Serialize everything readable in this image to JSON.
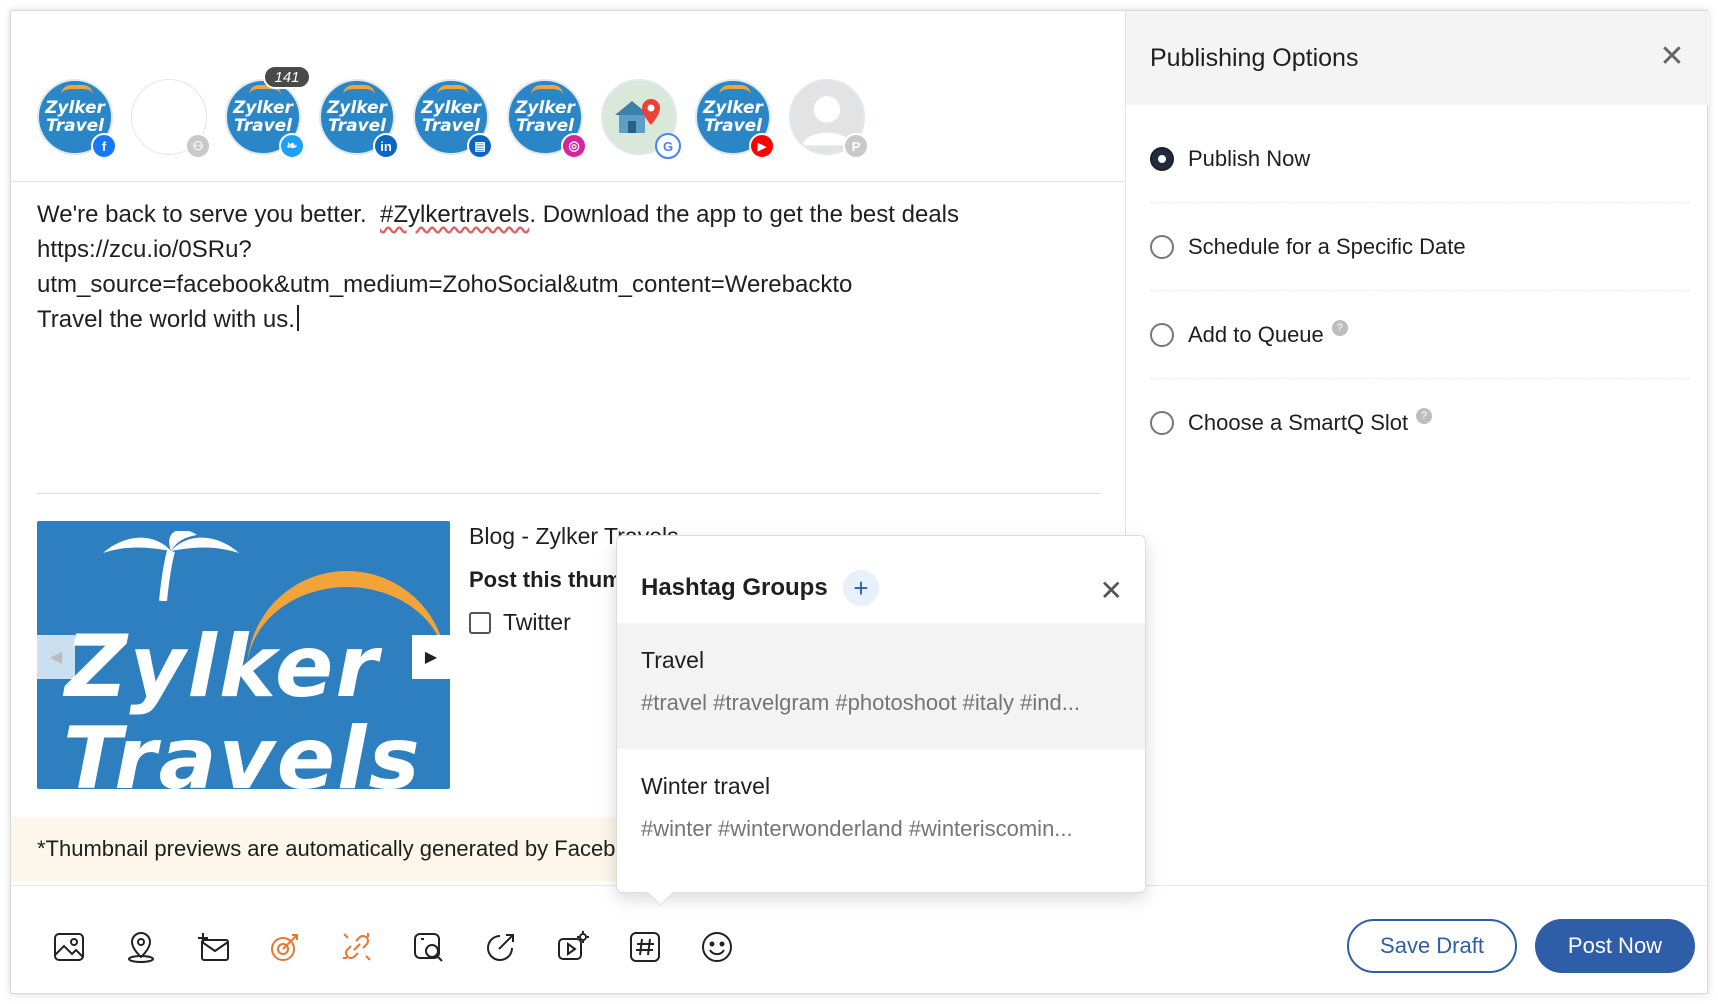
{
  "profiles": [
    {
      "name": "Zylker Travels",
      "network": "facebook",
      "badge_color": "#1877f2",
      "badge_glyph": "f"
    },
    {
      "name": "",
      "network": "group",
      "badge_color": "#c9c9c9",
      "badge_glyph": "⚇"
    },
    {
      "name": "Zylker Travels",
      "network": "twitter",
      "badge_color": "#1da1f2",
      "badge_glyph": "❧",
      "count": "141"
    },
    {
      "name": "Zylker Travels",
      "network": "linkedin",
      "badge_color": "#0a66c2",
      "badge_glyph": "in"
    },
    {
      "name": "Zylker Travels",
      "network": "linkedin-page",
      "badge_color": "#0a66c2",
      "badge_glyph": "▤"
    },
    {
      "name": "Zylker Travels",
      "network": "instagram",
      "badge_color": "#d6249f",
      "badge_glyph": "◎"
    },
    {
      "name": "",
      "network": "google-business",
      "badge_color": "#4285f4",
      "badge_glyph": "G"
    },
    {
      "name": "Zylker Travels",
      "network": "youtube",
      "badge_color": "#ff0000",
      "badge_glyph": "▶"
    },
    {
      "name": "",
      "network": "pinterest",
      "badge_color": "#c9c9c9",
      "badge_glyph": "P"
    }
  ],
  "post": {
    "line1_before": "We're back to serve you better.  ",
    "hashtag": "#Zylkertravels",
    "line1_after": ". Download the app to get the best deals",
    "line2": "https://zcu.io/0SRu?",
    "line3": "utm_source=facebook&utm_medium=ZohoSocial&utm_content=Werebackto",
    "line4": "Travel the world with us."
  },
  "link_preview": {
    "title": "Blog - Zylker Travels",
    "thumb_text_1": "Zylker",
    "thumb_text_2": "Travels",
    "post_thumbnail_label": "Post this thumbnail",
    "twitter_label": "Twitter",
    "note": "*Thumbnail previews are automatically generated by Facebook."
  },
  "toolbar": {
    "tools": [
      "image-icon",
      "location-icon",
      "mail-add-icon",
      "target-icon",
      "link-off-icon",
      "image-search-icon",
      "share-icon",
      "video-settings-icon",
      "hashtag-icon",
      "emoji-icon"
    ],
    "save_draft": "Save Draft",
    "post_now": "Post Now"
  },
  "publishing": {
    "title": "Publishing Options",
    "options": [
      {
        "label": "Publish Now",
        "selected": true,
        "help": false
      },
      {
        "label": "Schedule for a Specific Date",
        "selected": false,
        "help": false
      },
      {
        "label": "Add to Queue",
        "selected": false,
        "help": true
      },
      {
        "label": "Choose a SmartQ Slot",
        "selected": false,
        "help": true
      }
    ]
  },
  "hashtag_groups": {
    "title": "Hashtag Groups",
    "groups": [
      {
        "name": "Travel",
        "tags": "#travel #travelgram #photoshoot #italy #ind..."
      },
      {
        "name": "Winter travel",
        "tags": "#winter #winterwonderland #winteriscomin..."
      }
    ]
  },
  "colors": {
    "accent": "#2f5ea8",
    "note_bg": "#fdf6ea",
    "orange_icon": "#e8762c"
  }
}
